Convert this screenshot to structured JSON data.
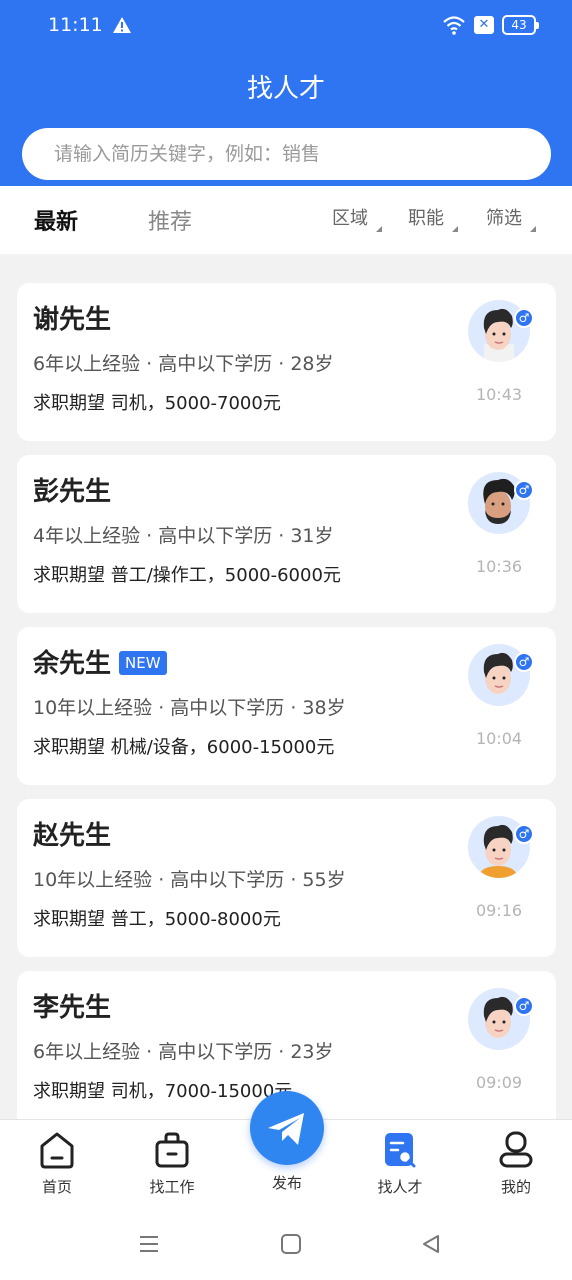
{
  "status_bar": {
    "time": "11:11",
    "battery": "43"
  },
  "header": {
    "title": "找人才"
  },
  "search": {
    "placeholder": "请输入简历关键字，例如：销售"
  },
  "tabs": {
    "latest": "最新",
    "recommended": "推荐"
  },
  "filters": {
    "area": "区域",
    "function": "职能",
    "screen": "筛选"
  },
  "cards": [
    {
      "name": "谢先生",
      "is_new": false,
      "meta": "6年以上经验 · 高中以下学历 · 28岁",
      "expect": "求职期望 司机，5000-7000元",
      "time": "10:43"
    },
    {
      "name": "彭先生",
      "is_new": false,
      "meta": "4年以上经验 · 高中以下学历 · 31岁",
      "expect": "求职期望 普工/操作工，5000-6000元",
      "time": "10:36"
    },
    {
      "name": "余先生",
      "is_new": true,
      "meta": "10年以上经验 · 高中以下学历 · 38岁",
      "expect": "求职期望 机械/设备，6000-15000元",
      "time": "10:04"
    },
    {
      "name": "赵先生",
      "is_new": false,
      "meta": "10年以上经验 · 高中以下学历 · 55岁",
      "expect": "求职期望 普工，5000-8000元",
      "time": "09:16"
    },
    {
      "name": "李先生",
      "is_new": false,
      "meta": "6年以上经验 · 高中以下学历 · 23岁",
      "expect": "求职期望 司机，7000-15000元",
      "time": "09:09"
    }
  ],
  "new_badge": "NEW",
  "bottom_nav": {
    "home": "首页",
    "find_job": "找工作",
    "publish": "发布",
    "find_talent": "找人才",
    "mine": "我的"
  },
  "colors": {
    "primary": "#2f74f0",
    "background": "#f2f2f2"
  }
}
